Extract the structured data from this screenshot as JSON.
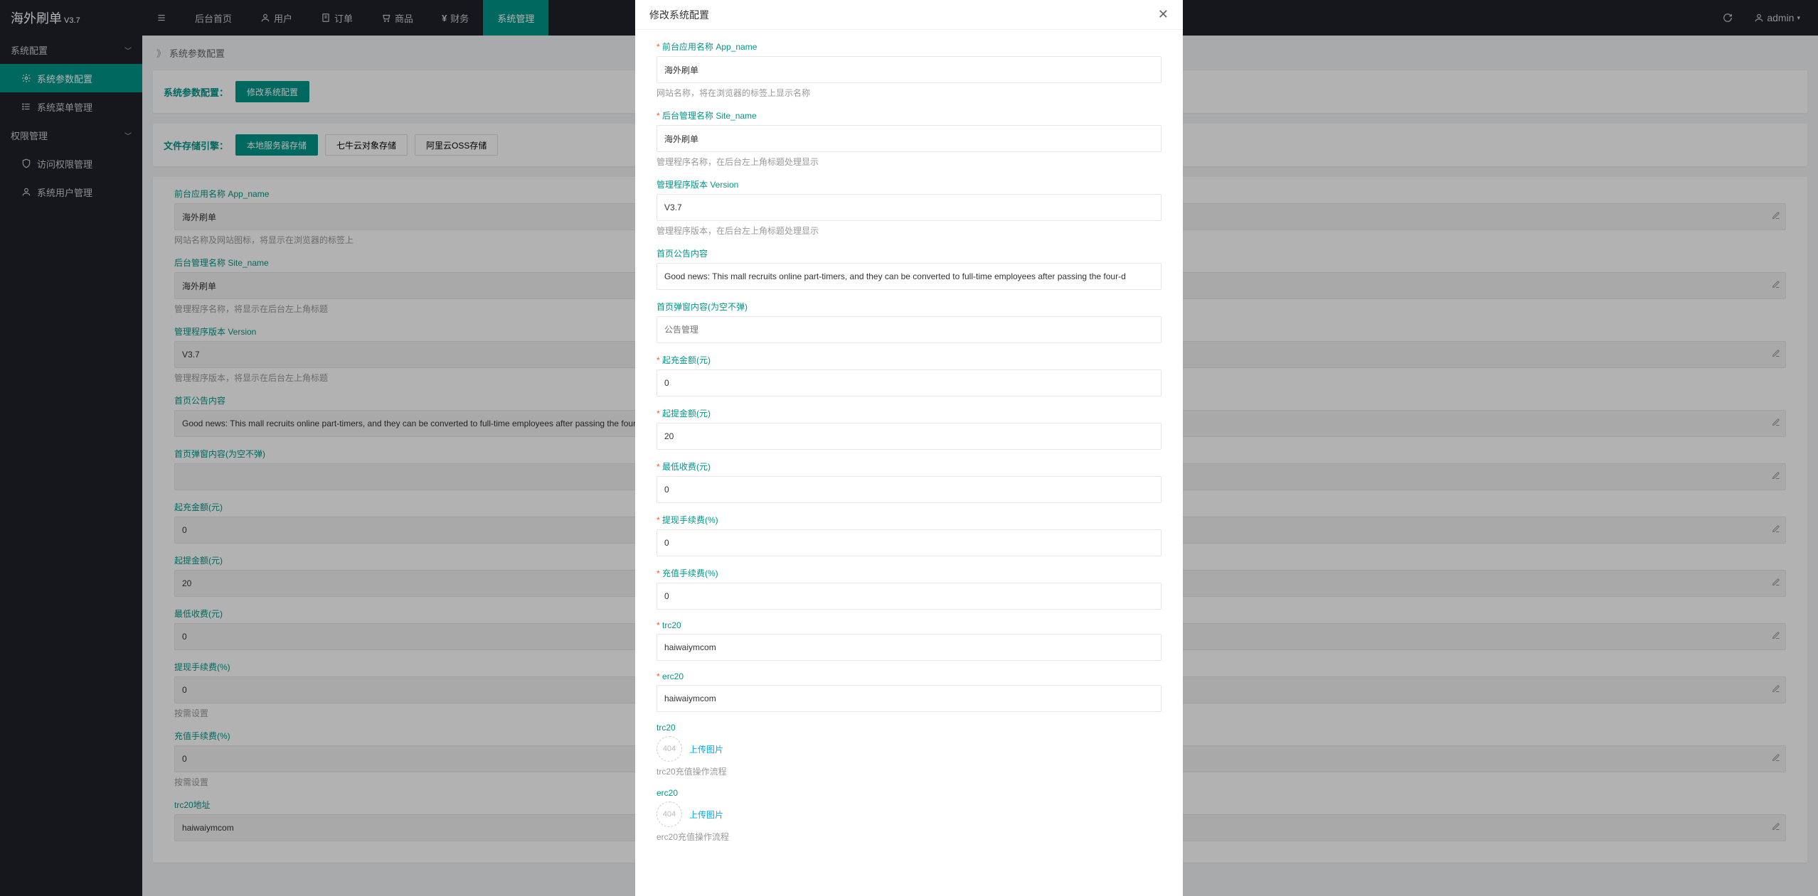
{
  "app": {
    "name": "海外刷单",
    "version": "V3.7"
  },
  "header": {
    "menu": [
      {
        "label": "后台首页",
        "icon": ""
      },
      {
        "label": "用户",
        "icon": "user"
      },
      {
        "label": "订单",
        "icon": "order"
      },
      {
        "label": "商品",
        "icon": "cart"
      },
      {
        "label": "财务",
        "icon": "yen"
      },
      {
        "label": "系统管理",
        "icon": ""
      }
    ],
    "user": "admin"
  },
  "sidebar": {
    "groups": [
      {
        "label": "系统配置",
        "items": [
          {
            "label": "系统参数配置",
            "icon": "gear"
          },
          {
            "label": "系统菜单管理",
            "icon": "list"
          }
        ]
      },
      {
        "label": "权限管理",
        "items": [
          {
            "label": "访问权限管理",
            "icon": "shield"
          },
          {
            "label": "系统用户管理",
            "icon": "user"
          }
        ]
      }
    ]
  },
  "breadcrumb": {
    "title": "系统参数配置"
  },
  "panel1": {
    "label": "系统参数配置：",
    "btn": "修改系统配置"
  },
  "panel2": {
    "label": "文件存储引擎：",
    "btns": [
      "本地服务器存储",
      "七牛云对象存储",
      "阿里云OSS存储"
    ]
  },
  "bgform": [
    {
      "label": "前台应用名称 App_name",
      "value": "海外刷单",
      "help": "网站名称及网站图标，将显示在浏览器的标签上"
    },
    {
      "label": "后台管理名称 Site_name",
      "value": "海外刷单",
      "help": "管理程序名称，将显示在后台左上角标题"
    },
    {
      "label": "管理程序版本 Version",
      "value": "V3.7",
      "help": "管理程序版本，将显示在后台左上角标题"
    },
    {
      "label": "首页公告内容",
      "value": "Good news: This mall recruits online part-timers, and they can be converted to full-time employees after passing the four-d"
    },
    {
      "label": "首页弹窗内容(为空不弹)",
      "value": ""
    },
    {
      "label": "起充金额(元)",
      "value": "0"
    },
    {
      "label": "起提金额(元)",
      "value": "20"
    },
    {
      "label": "最低收费(元)",
      "value": "0"
    },
    {
      "label": "提现手续费(%)",
      "value": "0",
      "help": "按需设置"
    },
    {
      "label": "充值手续费(%)",
      "value": "0",
      "help": "按需设置"
    },
    {
      "label": "trc20地址",
      "value": "haiwaiymcom"
    }
  ],
  "modal": {
    "title": "修改系统配置",
    "fields": {
      "app_name": {
        "label": "前台应用名称 App_name",
        "value": "海外刷单",
        "help": "网站名称，将在浏览器的标签上显示名称"
      },
      "site_name": {
        "label": "后台管理名称 Site_name",
        "value": "海外刷单",
        "help": "管理程序名称，在后台左上角标题处理显示"
      },
      "version": {
        "label": "管理程序版本 Version",
        "value": "V3.7",
        "help": "管理程序版本，在后台左上角标题处理显示"
      },
      "notice": {
        "label": "首页公告内容",
        "value": "Good news: This mall recruits online part-timers, and they can be converted to full-time employees after passing the four-d"
      },
      "popup": {
        "label": "首页弹窗内容(为空不弹)",
        "placeholder": "公告管理"
      },
      "min_recharge": {
        "label": "起充金额(元)",
        "value": "0"
      },
      "min_withdraw": {
        "label": "起提金额(元)",
        "value": "20"
      },
      "min_fee": {
        "label": "最低收费(元)",
        "value": "0"
      },
      "withdraw_fee": {
        "label": "提现手续费(%)",
        "value": "0"
      },
      "recharge_fee": {
        "label": "充值手续费(%)",
        "value": "0"
      },
      "trc20": {
        "label": "trc20",
        "value": "haiwaiymcom"
      },
      "erc20": {
        "label": "erc20",
        "value": "haiwaiymcom"
      },
      "trc20img": {
        "label": "trc20",
        "upload": "上传图片",
        "help": "trc20充值操作流程"
      },
      "erc20img": {
        "label": "erc20",
        "upload": "上传图片",
        "help": "erc20充值操作流程"
      }
    }
  },
  "icons": {
    "placeholder404": "404"
  }
}
